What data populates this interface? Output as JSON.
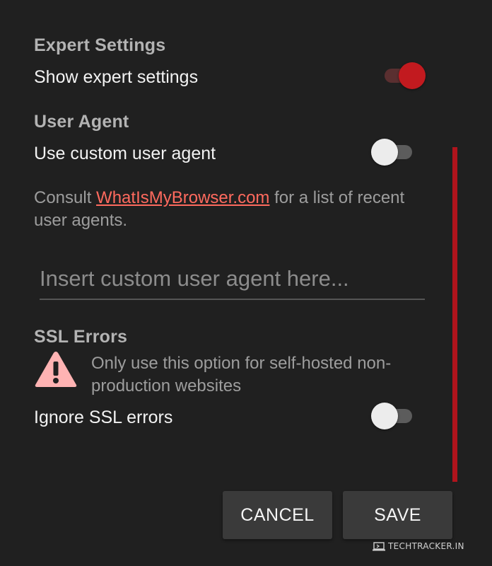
{
  "expert": {
    "section_title": "Expert Settings",
    "label": "Show expert settings",
    "enabled": true
  },
  "user_agent": {
    "section_title": "User Agent",
    "label": "Use custom user agent",
    "enabled": false,
    "desc_prefix": "Consult ",
    "link_text": "WhatIsMyBrowser.com",
    "desc_suffix": " for a list of recent user agents.",
    "input_placeholder": "Insert custom user agent here...",
    "input_value": ""
  },
  "ssl": {
    "section_title": "SSL Errors",
    "warning_icon": "warning-icon",
    "warning_text": "Only use this option for self-hosted non-production websites",
    "label": "Ignore SSL errors",
    "enabled": false
  },
  "dialog": {
    "cancel_label": "CANCEL",
    "save_label": "SAVE"
  },
  "watermark": {
    "text": "TECHTRACKER.IN",
    "icon": "laptop-icon"
  },
  "colors": {
    "background": "#202020",
    "accent": "#c21a1f",
    "link": "#ff6a5e",
    "warning": "#ffb3b3"
  }
}
